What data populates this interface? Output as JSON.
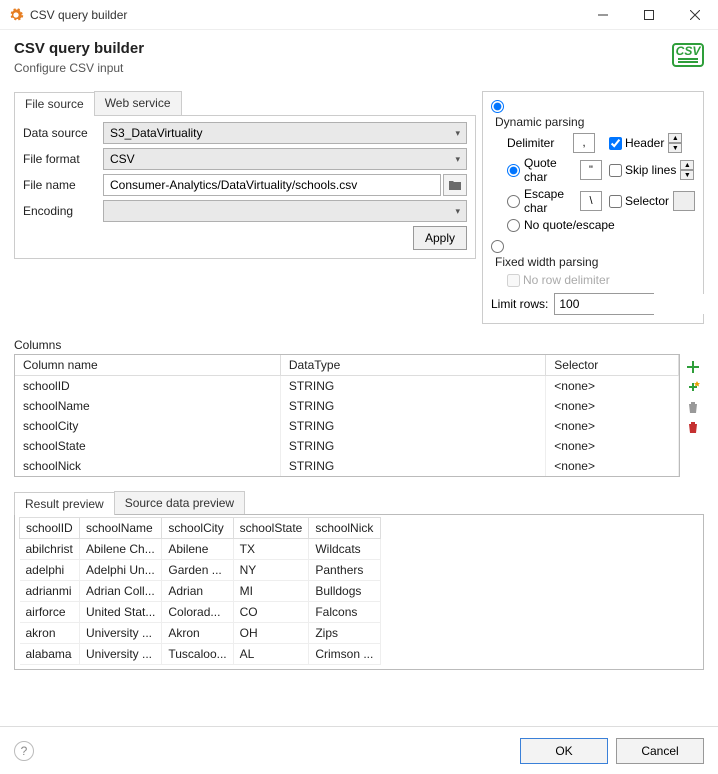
{
  "window": {
    "title": "CSV query builder"
  },
  "header": {
    "title": "CSV query builder",
    "subtitle": "Configure CSV input"
  },
  "source_tabs": {
    "file": "File source",
    "web": "Web service"
  },
  "form": {
    "data_source_label": "Data source",
    "data_source": "S3_DataVirtuality",
    "file_format_label": "File format",
    "file_format": "CSV",
    "file_name_label": "File name",
    "file_name": "Consumer-Analytics/DataVirtuality/schools.csv",
    "encoding_label": "Encoding",
    "encoding": "",
    "apply": "Apply"
  },
  "parsing": {
    "dynamic_label": "Dynamic parsing",
    "delimiter_label": "Delimiter",
    "delimiter_value": ",",
    "header_label": "Header",
    "header_checked": true,
    "quote_char_label": "Quote char",
    "quote_char_value": "\"",
    "skip_lines_label": "Skip lines",
    "escape_char_label": "Escape char",
    "escape_char_value": "\\",
    "selector_label": "Selector",
    "no_quote_label": "No quote/escape",
    "fixed_width_label": "Fixed width parsing",
    "no_row_delim_label": "No row delimiter",
    "limit_label": "Limit rows:",
    "limit_value": "100"
  },
  "columns": {
    "section_label": "Columns",
    "headers": {
      "name": "Column name",
      "type": "DataType",
      "selector": "Selector"
    },
    "rows": [
      {
        "name": "schoolID",
        "type": "STRING",
        "selector": "<none>"
      },
      {
        "name": "schoolName",
        "type": "STRING",
        "selector": "<none>"
      },
      {
        "name": "schoolCity",
        "type": "STRING",
        "selector": "<none>"
      },
      {
        "name": "schoolState",
        "type": "STRING",
        "selector": "<none>"
      },
      {
        "name": "schoolNick",
        "type": "STRING",
        "selector": "<none>"
      }
    ]
  },
  "preview": {
    "tab_result": "Result preview",
    "tab_source": "Source data preview",
    "headers": [
      "schoolID",
      "schoolName",
      "schoolCity",
      "schoolState",
      "schoolNick"
    ],
    "rows": [
      [
        "abilchrist",
        "Abilene Ch...",
        "Abilene",
        "TX",
        "Wildcats"
      ],
      [
        "adelphi",
        "Adelphi Un...",
        "Garden ...",
        "NY",
        "Panthers"
      ],
      [
        "adrianmi",
        "Adrian Coll...",
        "Adrian",
        "MI",
        "Bulldogs"
      ],
      [
        "airforce",
        "United Stat...",
        "Colorad...",
        "CO",
        "Falcons"
      ],
      [
        "akron",
        "University ...",
        "Akron",
        "OH",
        "Zips"
      ],
      [
        "alabama",
        "University ...",
        "Tuscaloo...",
        "AL",
        "Crimson ..."
      ]
    ]
  },
  "footer": {
    "ok": "OK",
    "cancel": "Cancel"
  }
}
